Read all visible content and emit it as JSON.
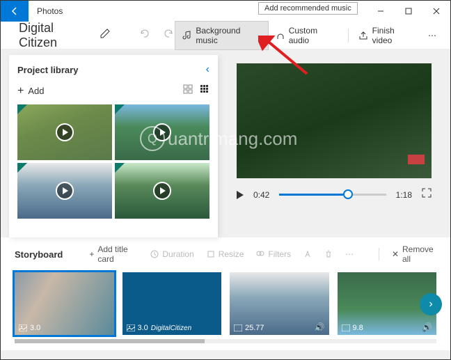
{
  "titlebar": {
    "app_title": "Photos",
    "tooltip": "Add recommended music"
  },
  "toolbar": {
    "project_name": "Digital Citizen",
    "background_music": "Background music",
    "custom_audio": "Custom audio",
    "finish_video": "Finish video"
  },
  "library": {
    "title": "Project library",
    "add_label": "Add"
  },
  "player": {
    "current_time": "0:42",
    "duration": "1:18"
  },
  "storyboard": {
    "title": "Storyboard",
    "add_title_card": "Add title card",
    "duration": "Duration",
    "resize": "Resize",
    "filters": "Filters",
    "remove_all": "Remove all",
    "clips": [
      {
        "duration": "3.0"
      },
      {
        "duration": "3.0",
        "label": "DigitalCitizen"
      },
      {
        "duration": "25.77"
      },
      {
        "duration": "9.8"
      }
    ]
  },
  "watermark": "uantrimang.com"
}
